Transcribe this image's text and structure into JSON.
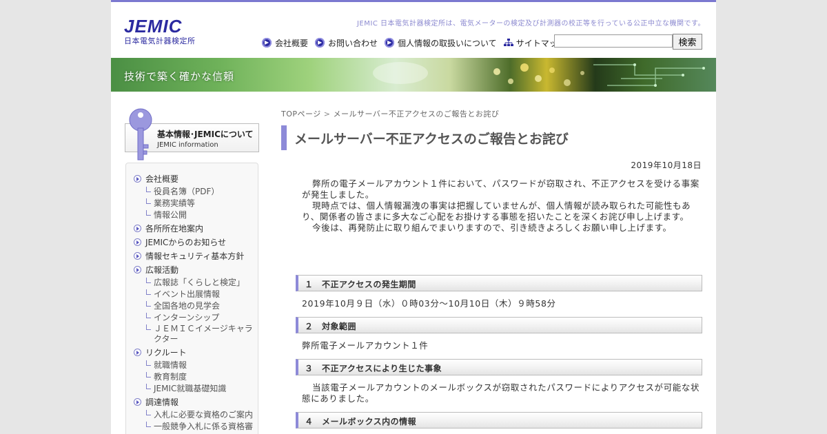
{
  "header": {
    "logo_main": "JEMIC",
    "logo_sub": "日本電気計器検定所",
    "tagline": "JEMIC 日本電気計器検定所は、電気メーターの検定及び計測器の校正等を行っている公正中立な機関です。",
    "nav": [
      {
        "label": "会社概要",
        "icon": "arrow-circle-icon"
      },
      {
        "label": "お問い合わせ",
        "icon": "arrow-circle-icon"
      },
      {
        "label": "個人情報の取扱いについて",
        "icon": "arrow-circle-icon"
      },
      {
        "label": "サイトマップ",
        "icon": "sitemap-icon"
      }
    ],
    "search_placeholder": "",
    "search_button": "検索"
  },
  "banner": {
    "title": "技術で築く確かな信頼"
  },
  "sidebar": {
    "heading_jp": "基本情報･JEMICについて",
    "heading_en": "JEMIC information",
    "menu": [
      {
        "label": "会社概要",
        "children": [
          "役員名簿（PDF）",
          "業務実績等",
          "情報公開"
        ]
      },
      {
        "label": "各所所在地案内",
        "children": []
      },
      {
        "label": "JEMICからのお知らせ",
        "children": []
      },
      {
        "label": "情報セキュリティ基本方針",
        "children": []
      },
      {
        "label": "広報活動",
        "children": [
          "広報誌「くらしと検定」",
          "イベント出展情報",
          "全国各地の見学会",
          "インターンシップ",
          "ＪＥＭＩＣイメージキャラクター"
        ]
      },
      {
        "label": "リクルート",
        "children": [
          "就職情報",
          "教育制度",
          "JEMIC就職基礎知識"
        ]
      },
      {
        "label": "調達情報",
        "children": [
          "入札に必要な資格のご案内",
          "一般競争入札に係る資格審"
        ]
      }
    ]
  },
  "main": {
    "breadcrumb": {
      "home": "TOPページ",
      "separator": ">",
      "current": "メールサーバー不正アクセスのご報告とお詫び"
    },
    "title": "メールサーバー不正アクセスのご報告とお詫び",
    "date": "2019年10月18日",
    "paragraphs": [
      "弊所の電子メールアカウント１件において、パスワードが窃取され、不正アクセスを受ける事案が発生しました。",
      "現時点では、個人情報漏洩の事実は把握していませんが、個人情報が読み取られた可能性もあり、関係者の皆さまに多大なご心配をお掛けする事態を招いたことを深くお詫び申し上げます。",
      "今後は、再発防止に取り組んでまいりますので、引き続きよろしくお願い申し上げます。"
    ],
    "sections": [
      {
        "heading": "１　不正アクセスの発生期間",
        "body": "2019年10月９日（水）０時03分～10月10日（木）９時58分"
      },
      {
        "heading": "２　対象範囲",
        "body": "弊所電子メールアカウント１件"
      },
      {
        "heading": "３　不正アクセスにより生じた事象",
        "body": "当該電子メールアカウントのメールボックスが窃取されたパスワードによりアクセスが可能な状態にありました。"
      },
      {
        "heading": "４　メールボックス内の情報",
        "body": ""
      }
    ]
  },
  "colors": {
    "accent": "#8d8ad8",
    "brand": "#2b2aa0",
    "top_border": "#7b78d0"
  }
}
